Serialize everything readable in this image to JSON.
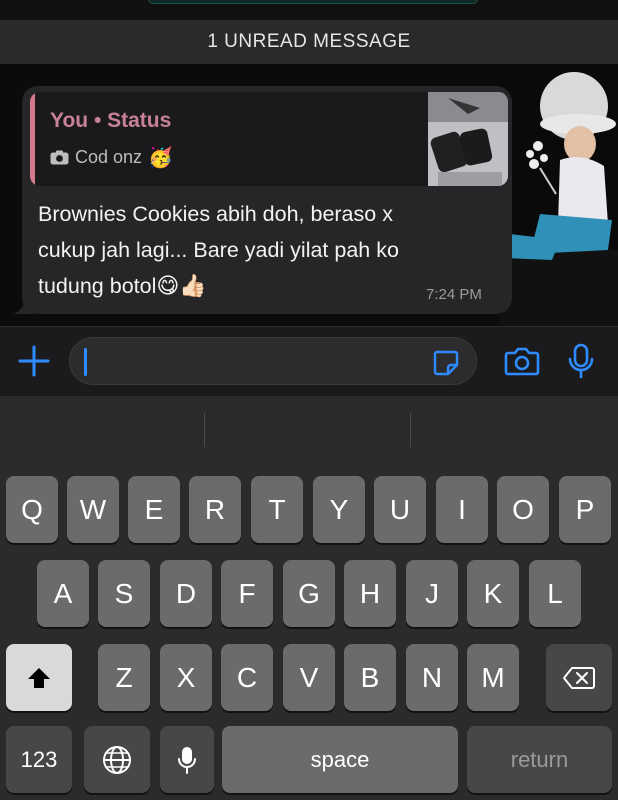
{
  "unread_banner": "1 UNREAD MESSAGE",
  "message": {
    "quoted": {
      "title": "You • Status",
      "caption": "Cod onz",
      "caption_emoji": "🥳",
      "caption_icon": "camera-icon"
    },
    "text_lines": [
      "Brownies Cookies abih doh, beraso x",
      "cukup jah lagi... Bare yadi yilat pah ko",
      "tudung botol"
    ],
    "trailing_emojis": "😋👍🏻",
    "time": "7:24 PM"
  },
  "input_bar": {
    "plus_icon": "plus-icon",
    "sticker_icon": "sticker-icon",
    "camera_icon": "camera-icon",
    "mic_icon": "microphone-icon",
    "text_value": ""
  },
  "keyboard": {
    "row1": [
      "Q",
      "W",
      "E",
      "R",
      "T",
      "Y",
      "U",
      "I",
      "O",
      "P"
    ],
    "row2": [
      "A",
      "S",
      "D",
      "F",
      "G",
      "H",
      "J",
      "K",
      "L"
    ],
    "row3": [
      "Z",
      "X",
      "C",
      "V",
      "B",
      "N",
      "M"
    ],
    "numbers_label": "123",
    "space_label": "space",
    "return_label": "return",
    "globe_icon": "globe-icon",
    "dictation_icon": "microphone-icon",
    "shift_icon": "shift-icon",
    "delete_icon": "backspace-icon"
  },
  "colors": {
    "accent": "#2f8cff",
    "quote_bar": "#d47a8f",
    "quote_title": "#c98198"
  }
}
